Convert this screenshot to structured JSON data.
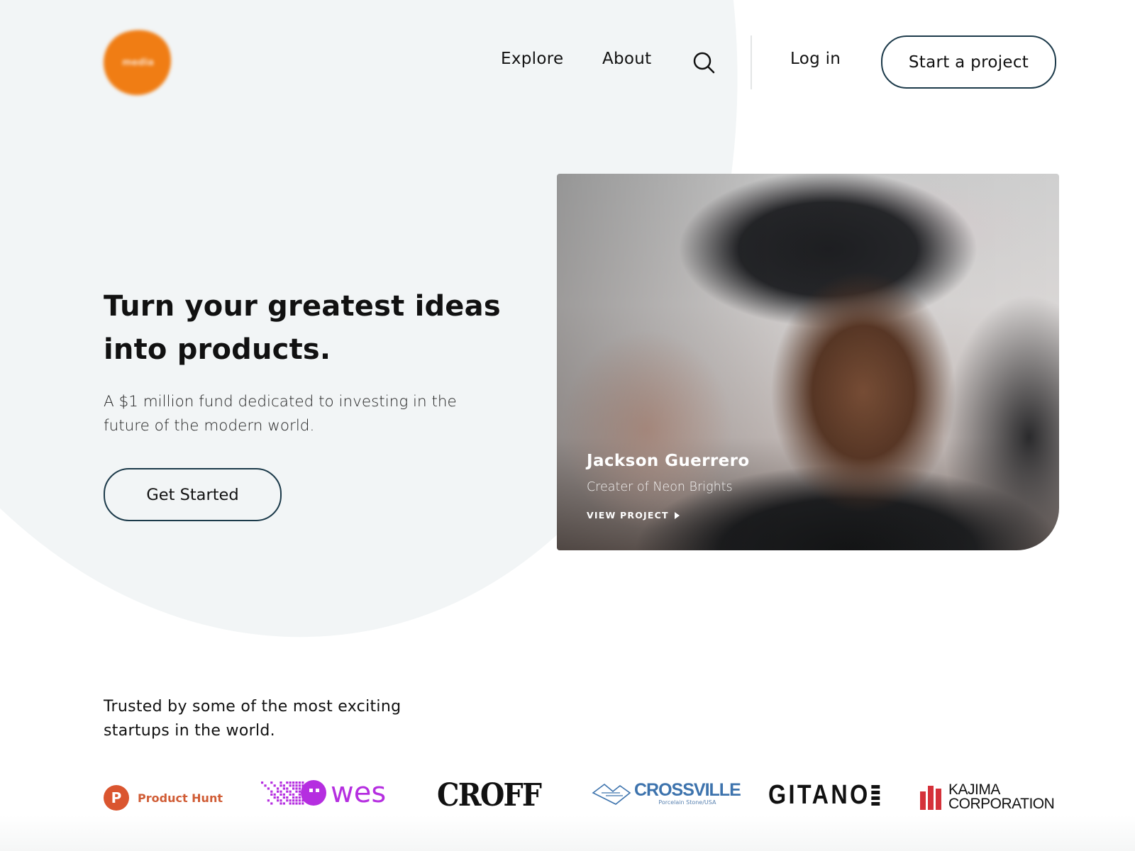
{
  "brand": {
    "logo_text": "media",
    "accent_color": "#f07d14"
  },
  "nav": {
    "items": [
      {
        "label": "Explore"
      },
      {
        "label": "About"
      }
    ],
    "search_icon": "search-icon",
    "login_label": "Log in",
    "cta_label": "Start a project"
  },
  "hero": {
    "title": "Turn your greatest ideas into products.",
    "subtitle": "A $1 million fund dedicated to investing in the future of the modern world.",
    "cta_label": "Get Started",
    "button_border_color": "#1c3a4a"
  },
  "featured": {
    "name": "Jackson Guerrero",
    "role": "Creater of Neon Brights",
    "link_label": "VIEW PROJECT",
    "link_icon": "play-icon"
  },
  "trusted": {
    "heading": "Trusted by some of the most exciting startups in the world.",
    "logos": [
      {
        "name": "Product Hunt",
        "mark": "P",
        "color": "#da552f"
      },
      {
        "name": "wes",
        "color": "#b52ee0"
      },
      {
        "name": "CROFF",
        "color": "#111111"
      },
      {
        "name": "CROSSVILLE",
        "tagline": "Porcelain Stone/USA",
        "color": "#3d73ad"
      },
      {
        "name": "GITANO",
        "color": "#111111"
      },
      {
        "name_line1": "KAJIMA",
        "name_line2": "CORPORATION",
        "color": "#d5313a"
      }
    ]
  }
}
